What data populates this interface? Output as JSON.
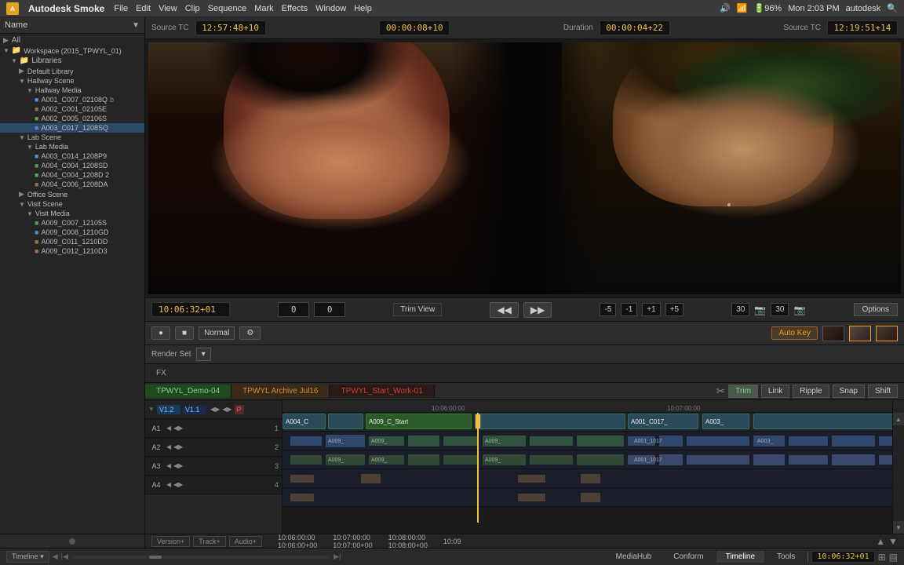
{
  "app": {
    "name": "Autodesk Smoke",
    "icon_label": "A"
  },
  "menu": {
    "items": [
      "File",
      "Edit",
      "View",
      "Clip",
      "Sequence",
      "Mark",
      "Effects",
      "Window",
      "Help"
    ]
  },
  "status_bar": {
    "time": "Mon 2:03 PM",
    "username": "autodesk"
  },
  "timecode_bar": {
    "source_tc_label": "Source TC",
    "source_tc_value": "12:57:48+10",
    "middle_tc_value": "00:00:08+10",
    "duration_label": "Duration",
    "duration_value": "00:00:04+22",
    "right_tc_label": "Source TC",
    "right_tc_value": "12:19:51+14"
  },
  "viewer": {
    "timecode": "10:06:32+01",
    "trim_view_label": "Trim View",
    "left_value": "0",
    "right_value": "0",
    "minus_5": "-5",
    "minus_1": "-1",
    "plus_1": "+1",
    "plus_5": "+5",
    "frame_count1": "30",
    "frame_count2": "30",
    "options_label": "Options"
  },
  "toolbar": {
    "normal_label": "Normal",
    "autokey_label": "Auto Key",
    "render_set_label": "Render Set",
    "fx_label": "FX"
  },
  "sidebar": {
    "header_label": "Name",
    "items": [
      {
        "label": "All",
        "type": "root",
        "indent": 0
      },
      {
        "label": "Workspace (2015_TPWYL_01)",
        "type": "workspace",
        "indent": 0,
        "expanded": true
      },
      {
        "label": "Libraries",
        "type": "folder",
        "indent": 1,
        "expanded": true
      },
      {
        "label": "Default Library",
        "type": "library",
        "indent": 2
      },
      {
        "label": "Hallway Scene",
        "type": "scene",
        "indent": 2,
        "expanded": true
      },
      {
        "label": "Hallway Media",
        "type": "media",
        "indent": 3,
        "expanded": true
      },
      {
        "label": "A001_C007_02108Q",
        "type": "clip_blue",
        "indent": 4,
        "suffix": "b"
      },
      {
        "label": "A002_C001_02105E",
        "type": "clip_brown",
        "indent": 4
      },
      {
        "label": "A002_C005_02106S",
        "type": "clip_green",
        "indent": 4
      },
      {
        "label": "A003_C017_1208SQ",
        "type": "clip_blue",
        "indent": 4,
        "selected": true
      },
      {
        "label": "Lab Scene",
        "type": "scene",
        "indent": 2,
        "expanded": true
      },
      {
        "label": "Lab Media",
        "type": "media",
        "indent": 3,
        "expanded": true
      },
      {
        "label": "A003_C014_1208P9",
        "type": "clip_blue",
        "indent": 4
      },
      {
        "label": "A004_C004_1208SD",
        "type": "clip_green",
        "indent": 4
      },
      {
        "label": "A004_C004_1208D 2",
        "type": "clip_green",
        "indent": 4
      },
      {
        "label": "A004_C006_1208DA",
        "type": "clip_brown",
        "indent": 4
      },
      {
        "label": "Office Scene",
        "type": "scene",
        "indent": 2
      },
      {
        "label": "Visit Scene",
        "type": "scene",
        "indent": 2,
        "expanded": true
      },
      {
        "label": "Visit Media",
        "type": "media",
        "indent": 3,
        "expanded": true
      },
      {
        "label": "A009_C007_12105S",
        "type": "clip_green",
        "indent": 4
      },
      {
        "label": "A009_C008_1210GD",
        "type": "clip_blue",
        "indent": 4
      },
      {
        "label": "A009_C011_1210DD",
        "type": "clip_brown",
        "indent": 4
      },
      {
        "label": "A009_C012_1210D3",
        "type": "clip_brown",
        "indent": 4
      }
    ]
  },
  "timeline_tabs": [
    {
      "label": "TPWYL_Demo-04",
      "type": "active"
    },
    {
      "label": "TPWYL Archive Jul16",
      "type": "archive"
    },
    {
      "label": "TPWYL_Start_Work-01",
      "type": "work"
    }
  ],
  "timeline_controls": {
    "trim_label": "Trim",
    "link_label": "Link",
    "ripple_label": "Ripple",
    "snap_label": "Snap",
    "shift_label": "Shift"
  },
  "tracks": {
    "video": [
      {
        "label": "V1.2",
        "sublabel": "V1.1",
        "type": "video"
      },
      {
        "label": "A1",
        "num": "1",
        "type": "audio"
      },
      {
        "label": "A2",
        "num": "2",
        "type": "audio"
      },
      {
        "label": "A3",
        "num": "3",
        "type": "audio"
      },
      {
        "label": "A4",
        "num": "4",
        "type": "audio"
      }
    ]
  },
  "footer": {
    "version_label": "Version+",
    "track_label": "Track+",
    "audio_label": "Audio+",
    "timecodes": [
      {
        "tc1": "10:06:00:00",
        "tc2": "10:06:00+00"
      },
      {
        "tc1": "10:07:00:00",
        "tc2": "10:07:00+00"
      },
      {
        "tc1": "10:08:00:00",
        "tc2": "10:08:00+00"
      },
      {
        "tc1": "10:09",
        "tc2": ""
      }
    ]
  },
  "bottom_tabs": [
    {
      "label": "MediaHub"
    },
    {
      "label": "Conform"
    },
    {
      "label": "Timeline",
      "active": true
    },
    {
      "label": "Tools"
    }
  ],
  "bottom_tc": "10:06:32+01"
}
